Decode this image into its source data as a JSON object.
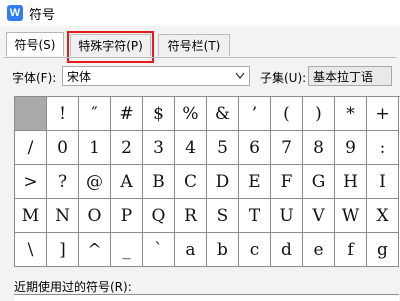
{
  "window": {
    "title": "符号",
    "app_icon_letter": "W",
    "brand_color": "#2f7cf6"
  },
  "tabs": [
    {
      "label": "符号(S)",
      "active": true
    },
    {
      "label": "特殊字符(P)",
      "active": false,
      "highlighted": true
    },
    {
      "label": "符号栏(T)",
      "active": false
    }
  ],
  "highlight_color": "#e31b1b",
  "font_select": {
    "label": "字体(F):",
    "value": "宋体"
  },
  "subset_select": {
    "label": "子集(U):",
    "value": "基本拉丁语"
  },
  "symbols": [
    "",
    "!",
    "″",
    "#",
    "$",
    "%",
    "&",
    "’",
    "(",
    ")",
    "*",
    "+",
    "/",
    "0",
    "1",
    "2",
    "3",
    "4",
    "5",
    "6",
    "7",
    "8",
    "9",
    ":",
    ">",
    "?",
    "@",
    "A",
    "B",
    "C",
    "D",
    "E",
    "F",
    "G",
    "H",
    "I",
    "M",
    "N",
    "O",
    "P",
    "Q",
    "R",
    "S",
    "T",
    "U",
    "V",
    "W",
    "X",
    "\\",
    "]",
    "^",
    "_",
    "`",
    "a",
    "b",
    "c",
    "d",
    "e",
    "f",
    "g"
  ],
  "selected_index": 0,
  "recent": {
    "label": "近期使用过的符号(R):"
  }
}
